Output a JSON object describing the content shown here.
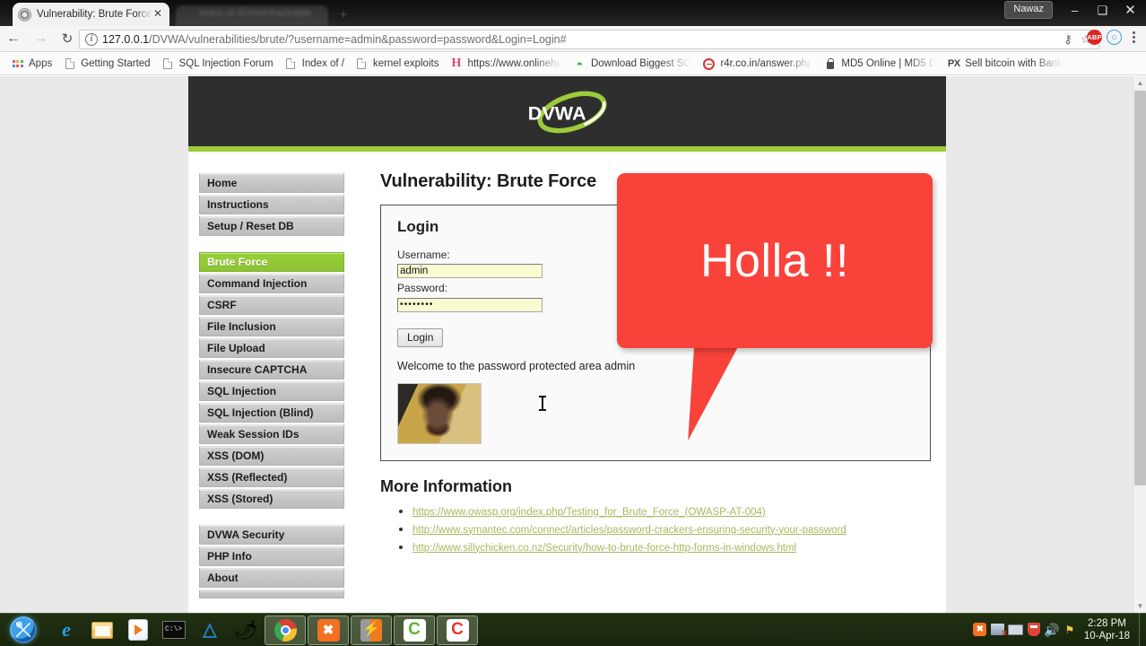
{
  "browser": {
    "tab": {
      "title": "Vulnerability: Brute Force",
      "favicon_icon": "globe-favicon-icon",
      "close_icon": "close-icon"
    },
    "background_tab": {
      "title": "Index of /DVWA/hackable"
    },
    "new_tab_label": "+",
    "window": {
      "user_label": "Nawaz",
      "minimize_label": "–",
      "maximize_label": "❑",
      "close_label": "✕"
    },
    "nav": {
      "back_label": "←",
      "forward_label": "→",
      "reload_label": "↻"
    },
    "omnibox": {
      "info_icon": "site-info-icon",
      "host": "127.0.0.1",
      "path": "/DVWA/vulnerabilities/brute/?username=admin&password=password&Login=Login#",
      "key_icon": "password-key-icon",
      "star_icon": "bookmark-star-icon"
    },
    "extensions": {
      "adblock_label": "ABP",
      "second_label": "○",
      "menu_icon": "kebab-menu-icon"
    },
    "bookmarks": [
      {
        "label": "Apps",
        "icon": "apps-grid-icon"
      },
      {
        "label": "Getting Started",
        "icon": "page-icon"
      },
      {
        "label": "SQL Injection Forum",
        "icon": "page-icon"
      },
      {
        "label": "Index of /",
        "icon": "page-icon"
      },
      {
        "label": "kernel exploits",
        "icon": "page-icon"
      },
      {
        "label": "https://www.onlineha",
        "icon": "hackthis-h-icon"
      },
      {
        "label": "Download Biggest SO",
        "icon": "wifi-icon"
      },
      {
        "label": "r4r.co.in/answer.php",
        "icon": "no-entry-icon"
      },
      {
        "label": "MD5 Online | MD5 D",
        "icon": "lock-icon"
      },
      {
        "label": "Sell bitcoin with Bank",
        "icon": "px-icon"
      }
    ]
  },
  "page": {
    "logo_text": "DVWA",
    "title": "Vulnerability: Brute Force",
    "sidebar": [
      {
        "label": "Home",
        "active": false
      },
      {
        "label": "Instructions",
        "active": false
      },
      {
        "label": "Setup / Reset DB",
        "active": false
      }
    ],
    "sidebar_vulns": [
      {
        "label": "Brute Force",
        "active": true
      },
      {
        "label": "Command Injection",
        "active": false
      },
      {
        "label": "CSRF",
        "active": false
      },
      {
        "label": "File Inclusion",
        "active": false
      },
      {
        "label": "File Upload",
        "active": false
      },
      {
        "label": "Insecure CAPTCHA",
        "active": false
      },
      {
        "label": "SQL Injection",
        "active": false
      },
      {
        "label": "SQL Injection (Blind)",
        "active": false
      },
      {
        "label": "Weak Session IDs",
        "active": false
      },
      {
        "label": "XSS (DOM)",
        "active": false
      },
      {
        "label": "XSS (Reflected)",
        "active": false
      },
      {
        "label": "XSS (Stored)",
        "active": false
      }
    ],
    "sidebar_meta": [
      {
        "label": "DVWA Security",
        "active": false
      },
      {
        "label": "PHP Info",
        "active": false
      },
      {
        "label": "About",
        "active": false
      }
    ],
    "login_box": {
      "heading": "Login",
      "username_label": "Username:",
      "username_value": "admin",
      "password_label": "Password:",
      "password_value": "••••••••",
      "submit_label": "Login",
      "welcome_text": "Welcome to the password protected area admin",
      "image_name": "surprised-face-photo"
    },
    "more_information": {
      "heading": "More Information",
      "links": [
        "https://www.owasp.org/index.php/Testing_for_Brute_Force_(OWASP-AT-004)",
        "http://www.symantec.com/connect/articles/password-crackers-ensuring-security-your-password",
        "http://www.sillychicken.co.nz/Security/how-to-brute-force-http-forms-in-windows.html"
      ]
    },
    "colors": {
      "header_bg": "#2e2e2e",
      "accent_green": "#9ccb3b",
      "link_green": "#a6b85e",
      "input_yellow": "#fbfbd2"
    }
  },
  "annotation": {
    "bubble_text": "Holla !!",
    "bubble_color": "#f9423a",
    "bubble_text_color": "#ffffff"
  },
  "taskbar": {
    "start_label": "Start",
    "items": [
      {
        "name": "internet-explorer-icon",
        "glyph": "e"
      },
      {
        "name": "file-explorer-icon",
        "glyph": ""
      },
      {
        "name": "windows-media-player-icon",
        "glyph": ""
      },
      {
        "name": "command-prompt-icon",
        "glyph": "C:\\>_"
      },
      {
        "name": "ossec-agent-icon",
        "glyph": ""
      },
      {
        "name": "firefox-icon",
        "glyph": "🦊"
      },
      {
        "name": "google-chrome-icon",
        "glyph": ""
      },
      {
        "name": "xampp-control-panel-icon",
        "glyph": "✖"
      },
      {
        "name": "owasp-zap-icon",
        "glyph": "⚡"
      },
      {
        "name": "ccleaner-icon",
        "glyph": "C"
      },
      {
        "name": "ccleaner-red-icon",
        "glyph": "C"
      }
    ],
    "tray": [
      {
        "name": "xampp-tray-icon",
        "glyph": "✖"
      },
      {
        "name": "network-disconnected-icon",
        "glyph": ""
      },
      {
        "name": "monitor-icon",
        "glyph": ""
      },
      {
        "name": "antivirus-shield-icon",
        "glyph": ""
      },
      {
        "name": "volume-icon",
        "glyph": "🔊"
      },
      {
        "name": "action-center-flag-icon",
        "glyph": "⚑"
      }
    ],
    "clock": {
      "time": "2:28 PM",
      "date": "10-Apr-18"
    }
  }
}
